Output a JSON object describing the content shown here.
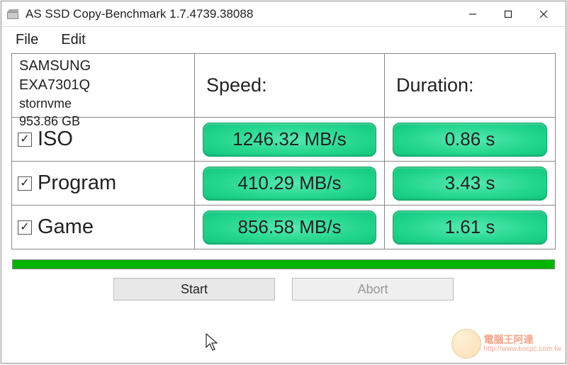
{
  "window": {
    "title": "AS SSD Copy-Benchmark 1.7.4739.38088"
  },
  "menu": {
    "file": "File",
    "edit": "Edit"
  },
  "device": {
    "vendor": "SAMSUNG",
    "model": "EXA7301Q",
    "driver": "stornvme",
    "capacity": "953.86 GB"
  },
  "headers": {
    "speed": "Speed:",
    "duration": "Duration:"
  },
  "tests": [
    {
      "name": "ISO",
      "checked": true,
      "speed": "1246.32 MB/s",
      "duration": "0.86 s"
    },
    {
      "name": "Program",
      "checked": true,
      "speed": "410.29 MB/s",
      "duration": "3.43 s"
    },
    {
      "name": "Game",
      "checked": true,
      "speed": "856.58 MB/s",
      "duration": "1.61 s"
    }
  ],
  "buttons": {
    "start": "Start",
    "abort": "Abort"
  },
  "watermark": {
    "text": "電腦王阿達",
    "url": "http://www.kocpc.com.tw"
  }
}
